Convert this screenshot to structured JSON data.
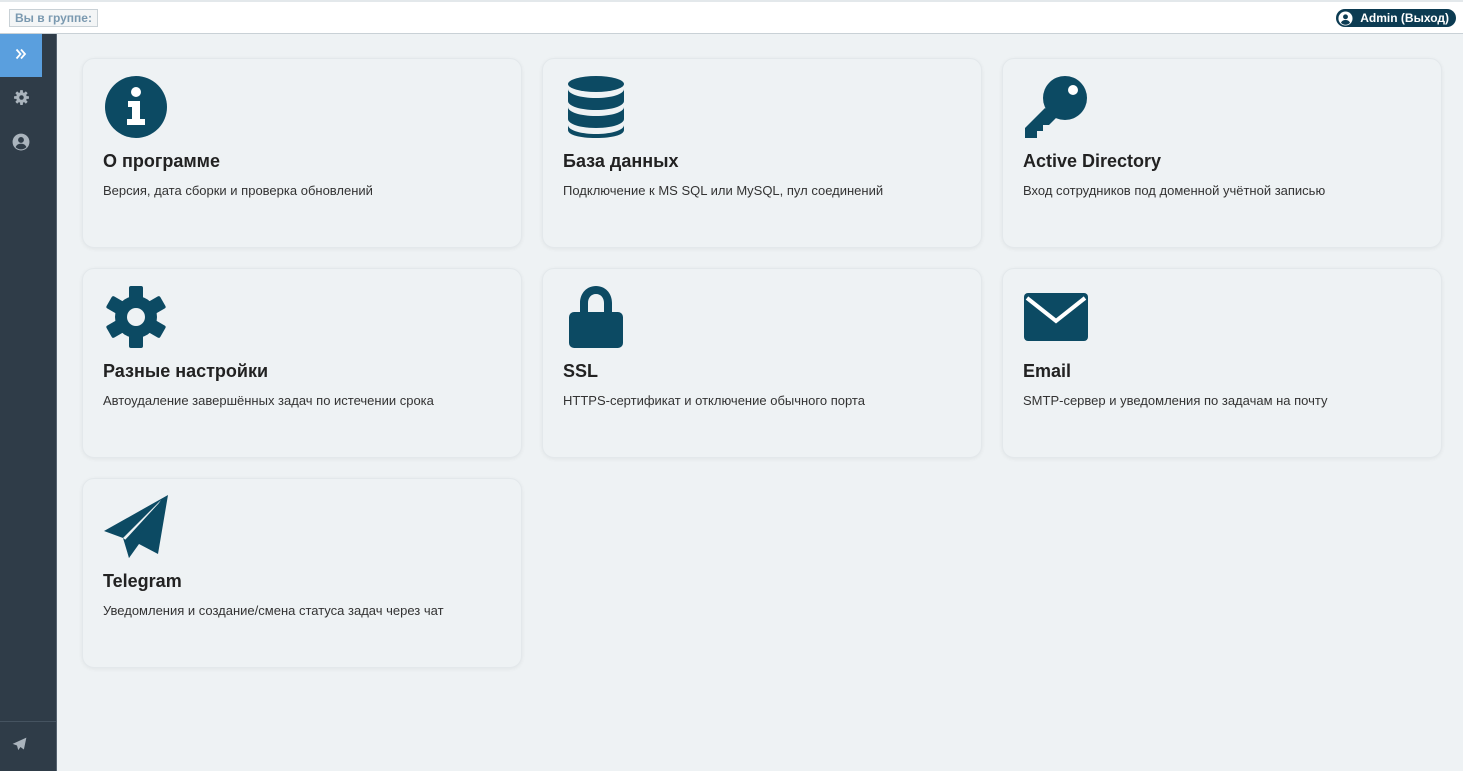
{
  "header": {
    "group_label": "Вы в группе:",
    "user_label": "Admin (Выход)",
    "user_icon": "user-circle-icon"
  },
  "sidebar": {
    "toggle_icon": "double-chevron-right-icon",
    "items": [
      {
        "icon": "gear-icon"
      },
      {
        "icon": "user-circle-icon"
      }
    ],
    "bottom_icon": "paper-plane-icon"
  },
  "colors": {
    "accent": "#0c4a63",
    "sidebar": "#2f3c48",
    "toggle": "#5a9fde",
    "background": "#eef2f4"
  },
  "cards": [
    {
      "icon": "info-icon",
      "title": "О программе",
      "desc": "Версия, дата сборки и проверка обновлений"
    },
    {
      "icon": "database-icon",
      "title": "База данных",
      "desc": "Подключение к MS SQL или MySQL, пул соединений"
    },
    {
      "icon": "key-icon",
      "title": "Active Directory",
      "desc": "Вход сотрудников под доменной учётной записью"
    },
    {
      "icon": "gear-icon",
      "title": "Разные настройки",
      "desc": "Автоудаление завершённых задач по истечении срока"
    },
    {
      "icon": "lock-icon",
      "title": "SSL",
      "desc": "HTTPS-сертификат и отключение обычного порта"
    },
    {
      "icon": "envelope-icon",
      "title": "Email",
      "desc": "SMTP-сервер и уведомления по задачам на почту"
    },
    {
      "icon": "paper-plane-icon",
      "title": "Telegram",
      "desc": "Уведомления и создание/смена статуса задач через чат"
    }
  ]
}
